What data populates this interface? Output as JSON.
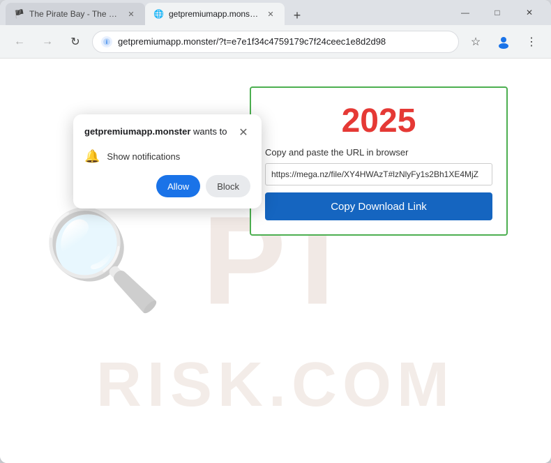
{
  "browser": {
    "tabs": [
      {
        "id": "tab1",
        "title": "The Pirate Bay - The galaxy's m...",
        "favicon": "🏴",
        "active": false
      },
      {
        "id": "tab2",
        "title": "getpremiumapp.monster/?t=e...",
        "favicon": "🔒",
        "active": true
      }
    ],
    "address": "getpremiumapp.monster/?t=e7e1f34c4759179c7f24ceec1e8d2d98",
    "new_tab_label": "+",
    "nav": {
      "back": "←",
      "forward": "→",
      "refresh": "↻"
    }
  },
  "window_controls": {
    "minimize": "—",
    "maximize": "□",
    "close": "✕"
  },
  "address_bar_icons": {
    "bookmark": "☆",
    "profile": "👤",
    "menu": "⋮"
  },
  "notification_popup": {
    "site": "getpremiumapp.monster",
    "wants_to": "wants to",
    "permission_label": "Show notifications",
    "allow_label": "Allow",
    "block_label": "Block",
    "close_label": "✕"
  },
  "page": {
    "year": "2025",
    "copy_label": "Copy and paste the URL in browser",
    "url_value": "https://mega.nz/file/XY4HWAzT#lzNlyFy1s2Bh1XE4MjZ",
    "copy_button_label": "Copy Download Link"
  }
}
